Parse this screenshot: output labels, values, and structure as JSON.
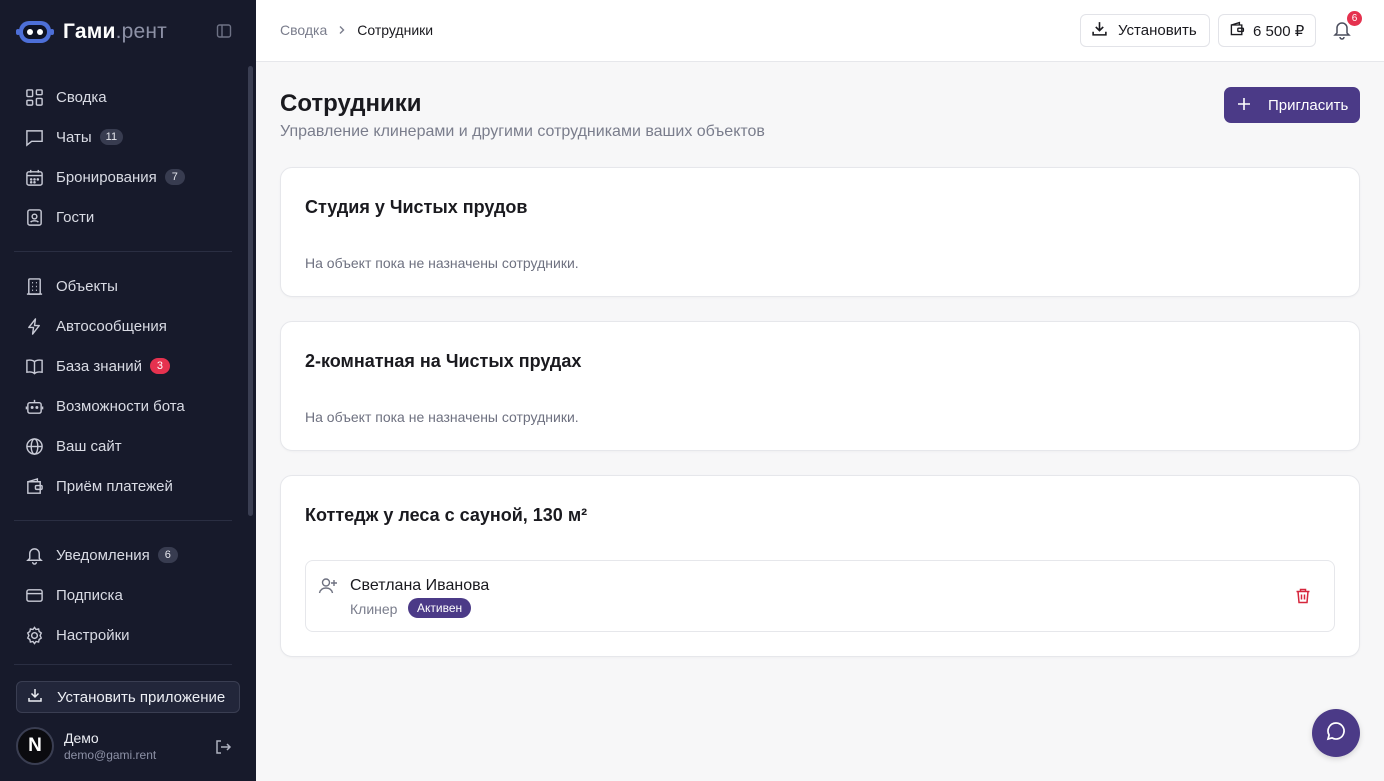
{
  "app": {
    "logo_main": "Гами",
    "logo_suffix": ".рент"
  },
  "sidebar": {
    "nav_primary": [
      {
        "label": "Сводка",
        "icon": "dashboard-icon"
      },
      {
        "label": "Чаты",
        "icon": "chat-icon",
        "badge": "11"
      },
      {
        "label": "Бронирования",
        "icon": "calendar-icon",
        "badge": "7"
      },
      {
        "label": "Гости",
        "icon": "guest-card-icon"
      }
    ],
    "nav_secondary": [
      {
        "label": "Объекты",
        "icon": "building-icon"
      },
      {
        "label": "Автосообщения",
        "icon": "lightning-icon"
      },
      {
        "label": "База знаний",
        "icon": "book-icon",
        "badge": "3"
      },
      {
        "label": "Возможности бота",
        "icon": "bot-icon"
      },
      {
        "label": "Ваш сайт",
        "icon": "globe-icon"
      },
      {
        "label": "Приём платежей",
        "icon": "wallet-icon"
      }
    ],
    "nav_tertiary": [
      {
        "label": "Уведомления",
        "icon": "bell-icon",
        "badge": "6"
      },
      {
        "label": "Подписка",
        "icon": "credit-card-icon"
      },
      {
        "label": "Настройки",
        "icon": "gear-icon"
      }
    ],
    "install_app_label": "Установить приложение",
    "user": {
      "initial": "N",
      "name": "Демо",
      "email": "demo@gami.rent"
    }
  },
  "topbar": {
    "breadcrumb": {
      "parent": "Сводка",
      "current": "Сотрудники"
    },
    "install_label": "Установить",
    "balance_label": "6 500 ₽",
    "notifications_count": "6"
  },
  "main": {
    "title": "Сотрудники",
    "subtitle": "Управление клинерами и другими сотрудниками ваших объектов",
    "invite_label": "Пригласить",
    "properties": [
      {
        "name": "Студия у Чистых прудов",
        "empty_text": "На объект пока не назначены сотрудники."
      },
      {
        "name": "2-комнатная на Чистых прудах",
        "empty_text": "На объект пока не назначены сотрудники."
      },
      {
        "name": "Коттедж у леса с сауной, 130 м²",
        "staff": [
          {
            "name": "Светлана Иванова",
            "role": "Клинер",
            "status": "Активен"
          }
        ]
      }
    ]
  },
  "colors": {
    "sidebar_bg": "#171a2b",
    "accent": "#4b3a87",
    "badge_red": "#e5324f",
    "danger": "#d6263c"
  }
}
